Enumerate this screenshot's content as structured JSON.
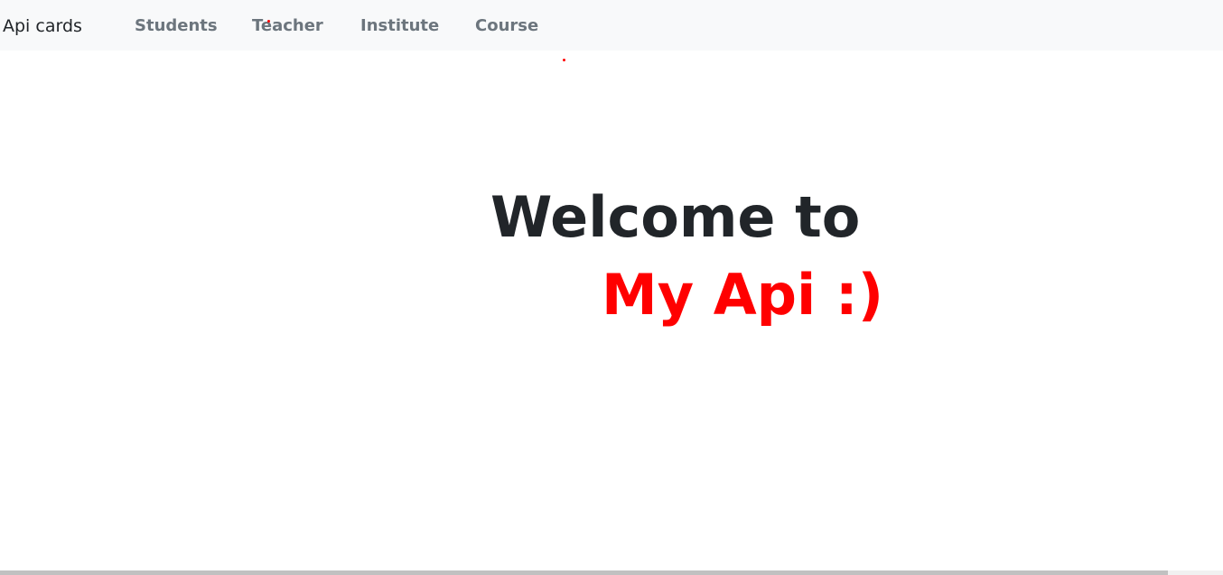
{
  "navbar": {
    "brand": "Api cards",
    "links": [
      {
        "label": "Students"
      },
      {
        "label": "Teacher"
      },
      {
        "label": "Institute"
      },
      {
        "label": "Course"
      }
    ]
  },
  "hero": {
    "line1": "Welcome to",
    "line2": "My Api :)"
  },
  "colors": {
    "navbar_bg": "#f8f9fa",
    "brand_text": "#212529",
    "nav_link": "#6c757d",
    "heading_dark": "#212529",
    "accent_red": "#ff0000"
  }
}
